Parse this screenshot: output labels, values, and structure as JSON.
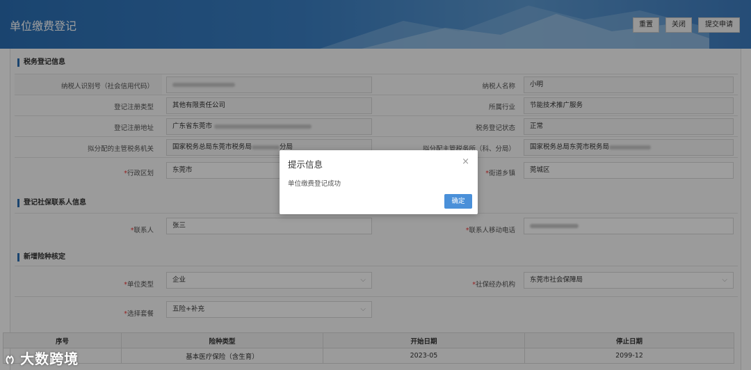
{
  "header": {
    "title": "单位缴费登记",
    "buttons": [
      "重置",
      "关闭",
      "提交申请"
    ]
  },
  "tax_section": {
    "title": "税务登记信息",
    "rows": [
      {
        "l_label": "纳税人识别号（社会信用代码）",
        "l_value": "",
        "r_label": "纳税人名称",
        "r_value": "小明"
      },
      {
        "l_label": "登记注册类型",
        "l_value": "其他有限责任公司",
        "r_label": "所属行业",
        "r_value": "节能技术推广服务"
      },
      {
        "l_label": "登记注册地址",
        "l_value": "广东省东莞市",
        "r_label": "税务登记状态",
        "r_value": "正常"
      },
      {
        "l_label": "拟分配的主管税务机关",
        "l_value": "国家税务总局东莞市税务局",
        "l_value_tail": "分局",
        "r_label": "拟分配主管税务所（科、分局）",
        "r_value": "国家税务总局东莞市税务局"
      },
      {
        "l_label": "*行政区划",
        "l_value": "东莞市",
        "r_label": "*街道乡镇",
        "r_value": "莞城区"
      }
    ]
  },
  "contact_section": {
    "title": "登记社保联系人信息",
    "contact_label": "*联系人",
    "contact_value": "张三",
    "phone_label": "*联系人移动电话",
    "phone_value": ""
  },
  "insurance_section": {
    "title": "新增险种核定",
    "unit_type_label": "*单位类型",
    "unit_type_value": "企业",
    "agency_label": "*社保经办机构",
    "agency_value": "东莞市社会保障局",
    "package_label": "*选择套餐",
    "package_value": "五险+补充"
  },
  "table": {
    "headers": [
      "序号",
      "险种类型",
      "开始日期",
      "停止日期"
    ],
    "rows": [
      [
        "",
        "基本医疗保险（含生育）",
        "2023-05",
        "2099-12"
      ]
    ]
  },
  "dialog": {
    "title": "提示信息",
    "close": "×",
    "message": "单位缴费登记成功",
    "ok": "确定"
  },
  "watermark": "大数跨境"
}
